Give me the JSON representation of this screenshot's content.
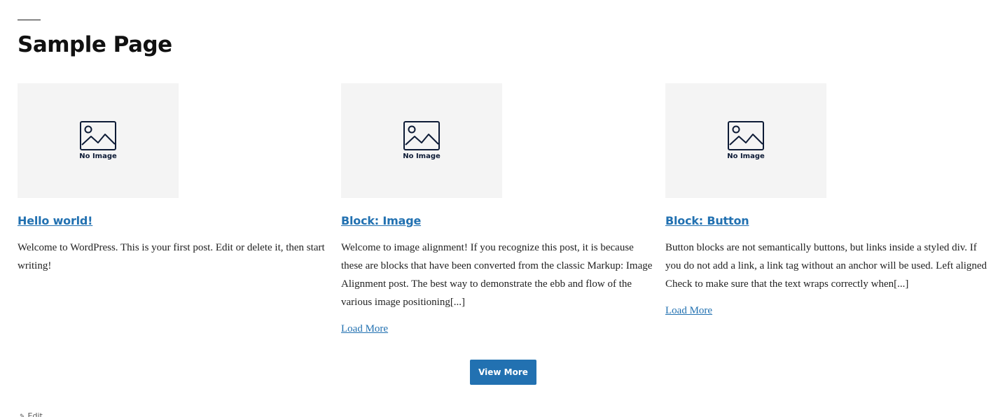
{
  "page": {
    "title": "Sample Page"
  },
  "placeholder": {
    "label": "No Image"
  },
  "posts": [
    {
      "title": "Hello world!",
      "excerpt": "Welcome to WordPress. This is your first post. Edit or delete it, then start writing!",
      "load_more": ""
    },
    {
      "title": "Block: Image",
      "excerpt": "Welcome to image alignment! If you recognize this post, it is because these are blocks that have been converted from the classic Markup: Image Alignment post. The best way to demonstrate the ebb and flow of the various image positioning[...]",
      "load_more": "Load More"
    },
    {
      "title": "Block: Button",
      "excerpt": "Button blocks are not semantically buttons, but links inside a styled div.  If you do not add a link, a link tag without an anchor will be used. Left aligned Check to make sure that the text wraps correctly when[...]",
      "load_more": "Load More"
    }
  ],
  "view_more": {
    "label": "View More"
  },
  "edit": {
    "label": "Edit",
    "icon": "pencil-icon"
  },
  "colors": {
    "accent": "#2271b1",
    "placeholder_bg": "#f4f4f4",
    "placeholder_icon": "#0d1b36"
  }
}
